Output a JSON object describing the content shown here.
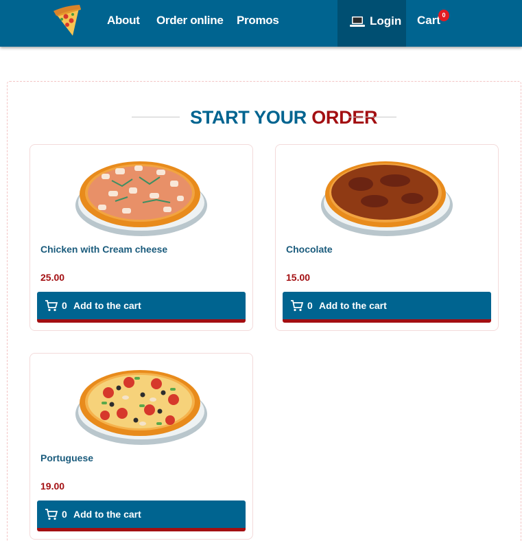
{
  "nav": {
    "about": "About",
    "order_online": "Order online",
    "promos": "Promos",
    "login": "Login",
    "cart": "Cart",
    "cart_count": "0",
    "logo_icon": "pizza-slice-icon",
    "login_icon": "laptop-icon"
  },
  "section": {
    "title_part1": "START YOUR",
    "title_part2": "ORDER"
  },
  "products": [
    {
      "name": "Chicken with Cream cheese",
      "price": "25.00",
      "qty": "0",
      "button_label": "Add to the cart"
    },
    {
      "name": "Chocolate",
      "price": "15.00",
      "qty": "0",
      "button_label": "Add to the cart"
    },
    {
      "name": "Portuguese",
      "price": "19.00",
      "qty": "0",
      "button_label": "Add to the cart"
    }
  ],
  "colors": {
    "primary": "#006490",
    "primary_dark": "#004f72",
    "accent": "#a30f12",
    "badge": "#e31b23"
  }
}
